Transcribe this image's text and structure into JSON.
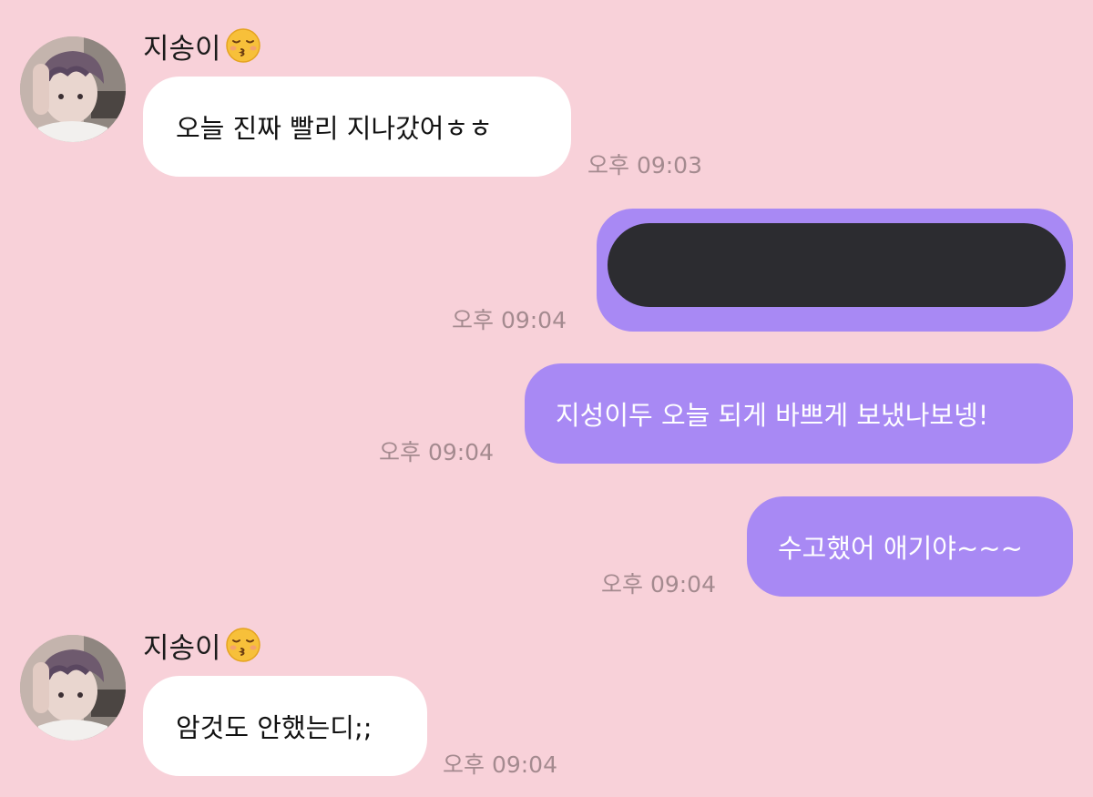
{
  "colors": {
    "background": "#f8d1d9",
    "incoming_bubble": "#ffffff",
    "outgoing_bubble": "#a889f4",
    "redaction": "#2c2c30",
    "timestamp": "#a48a8f"
  },
  "messages": [
    {
      "direction": "incoming",
      "sender": "지송이",
      "sender_emoji": "kissing-closed-eyes-emoji",
      "text": "오늘 진짜 빨리 지나갔어ㅎㅎ",
      "time": "오후 09:03"
    },
    {
      "direction": "outgoing",
      "redacted": true,
      "text": "",
      "time": "오후 09:04"
    },
    {
      "direction": "outgoing",
      "text": "지성이두 오늘 되게 바쁘게 보냈나보넹!",
      "time": "오후 09:04"
    },
    {
      "direction": "outgoing",
      "text": "수고했어 애기야~~~",
      "time": "오후 09:04"
    },
    {
      "direction": "incoming",
      "sender": "지송이",
      "sender_emoji": "kissing-closed-eyes-emoji",
      "text": "암것도 안했는디;;",
      "time": "오후 09:04"
    }
  ]
}
